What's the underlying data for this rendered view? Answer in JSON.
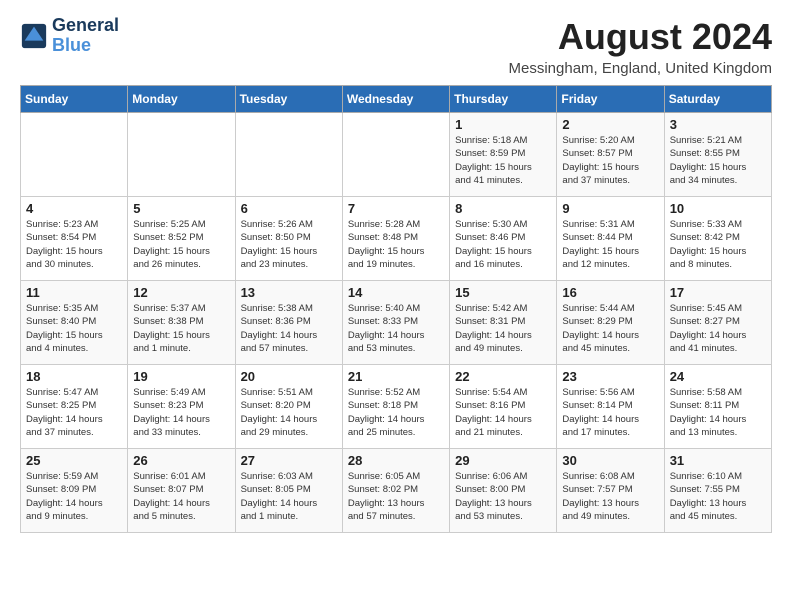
{
  "logo": {
    "line1": "General",
    "line2": "Blue"
  },
  "title": "August 2024",
  "location": "Messingham, England, United Kingdom",
  "days_of_week": [
    "Sunday",
    "Monday",
    "Tuesday",
    "Wednesday",
    "Thursday",
    "Friday",
    "Saturday"
  ],
  "weeks": [
    [
      {
        "day": "",
        "info": ""
      },
      {
        "day": "",
        "info": ""
      },
      {
        "day": "",
        "info": ""
      },
      {
        "day": "",
        "info": ""
      },
      {
        "day": "1",
        "info": "Sunrise: 5:18 AM\nSunset: 8:59 PM\nDaylight: 15 hours\nand 41 minutes."
      },
      {
        "day": "2",
        "info": "Sunrise: 5:20 AM\nSunset: 8:57 PM\nDaylight: 15 hours\nand 37 minutes."
      },
      {
        "day": "3",
        "info": "Sunrise: 5:21 AM\nSunset: 8:55 PM\nDaylight: 15 hours\nand 34 minutes."
      }
    ],
    [
      {
        "day": "4",
        "info": "Sunrise: 5:23 AM\nSunset: 8:54 PM\nDaylight: 15 hours\nand 30 minutes."
      },
      {
        "day": "5",
        "info": "Sunrise: 5:25 AM\nSunset: 8:52 PM\nDaylight: 15 hours\nand 26 minutes."
      },
      {
        "day": "6",
        "info": "Sunrise: 5:26 AM\nSunset: 8:50 PM\nDaylight: 15 hours\nand 23 minutes."
      },
      {
        "day": "7",
        "info": "Sunrise: 5:28 AM\nSunset: 8:48 PM\nDaylight: 15 hours\nand 19 minutes."
      },
      {
        "day": "8",
        "info": "Sunrise: 5:30 AM\nSunset: 8:46 PM\nDaylight: 15 hours\nand 16 minutes."
      },
      {
        "day": "9",
        "info": "Sunrise: 5:31 AM\nSunset: 8:44 PM\nDaylight: 15 hours\nand 12 minutes."
      },
      {
        "day": "10",
        "info": "Sunrise: 5:33 AM\nSunset: 8:42 PM\nDaylight: 15 hours\nand 8 minutes."
      }
    ],
    [
      {
        "day": "11",
        "info": "Sunrise: 5:35 AM\nSunset: 8:40 PM\nDaylight: 15 hours\nand 4 minutes."
      },
      {
        "day": "12",
        "info": "Sunrise: 5:37 AM\nSunset: 8:38 PM\nDaylight: 15 hours\nand 1 minute."
      },
      {
        "day": "13",
        "info": "Sunrise: 5:38 AM\nSunset: 8:36 PM\nDaylight: 14 hours\nand 57 minutes."
      },
      {
        "day": "14",
        "info": "Sunrise: 5:40 AM\nSunset: 8:33 PM\nDaylight: 14 hours\nand 53 minutes."
      },
      {
        "day": "15",
        "info": "Sunrise: 5:42 AM\nSunset: 8:31 PM\nDaylight: 14 hours\nand 49 minutes."
      },
      {
        "day": "16",
        "info": "Sunrise: 5:44 AM\nSunset: 8:29 PM\nDaylight: 14 hours\nand 45 minutes."
      },
      {
        "day": "17",
        "info": "Sunrise: 5:45 AM\nSunset: 8:27 PM\nDaylight: 14 hours\nand 41 minutes."
      }
    ],
    [
      {
        "day": "18",
        "info": "Sunrise: 5:47 AM\nSunset: 8:25 PM\nDaylight: 14 hours\nand 37 minutes."
      },
      {
        "day": "19",
        "info": "Sunrise: 5:49 AM\nSunset: 8:23 PM\nDaylight: 14 hours\nand 33 minutes."
      },
      {
        "day": "20",
        "info": "Sunrise: 5:51 AM\nSunset: 8:20 PM\nDaylight: 14 hours\nand 29 minutes."
      },
      {
        "day": "21",
        "info": "Sunrise: 5:52 AM\nSunset: 8:18 PM\nDaylight: 14 hours\nand 25 minutes."
      },
      {
        "day": "22",
        "info": "Sunrise: 5:54 AM\nSunset: 8:16 PM\nDaylight: 14 hours\nand 21 minutes."
      },
      {
        "day": "23",
        "info": "Sunrise: 5:56 AM\nSunset: 8:14 PM\nDaylight: 14 hours\nand 17 minutes."
      },
      {
        "day": "24",
        "info": "Sunrise: 5:58 AM\nSunset: 8:11 PM\nDaylight: 14 hours\nand 13 minutes."
      }
    ],
    [
      {
        "day": "25",
        "info": "Sunrise: 5:59 AM\nSunset: 8:09 PM\nDaylight: 14 hours\nand 9 minutes."
      },
      {
        "day": "26",
        "info": "Sunrise: 6:01 AM\nSunset: 8:07 PM\nDaylight: 14 hours\nand 5 minutes."
      },
      {
        "day": "27",
        "info": "Sunrise: 6:03 AM\nSunset: 8:05 PM\nDaylight: 14 hours\nand 1 minute."
      },
      {
        "day": "28",
        "info": "Sunrise: 6:05 AM\nSunset: 8:02 PM\nDaylight: 13 hours\nand 57 minutes."
      },
      {
        "day": "29",
        "info": "Sunrise: 6:06 AM\nSunset: 8:00 PM\nDaylight: 13 hours\nand 53 minutes."
      },
      {
        "day": "30",
        "info": "Sunrise: 6:08 AM\nSunset: 7:57 PM\nDaylight: 13 hours\nand 49 minutes."
      },
      {
        "day": "31",
        "info": "Sunrise: 6:10 AM\nSunset: 7:55 PM\nDaylight: 13 hours\nand 45 minutes."
      }
    ]
  ]
}
